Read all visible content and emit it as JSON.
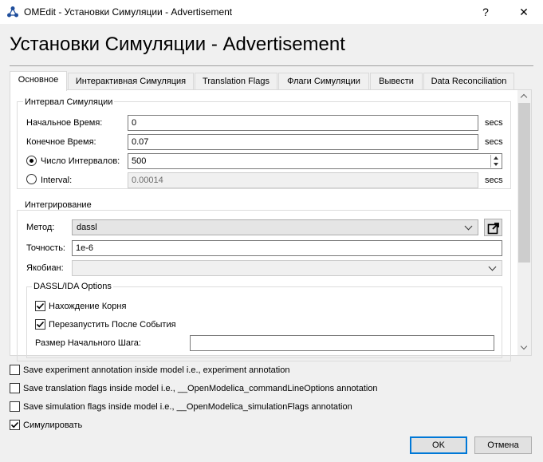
{
  "window": {
    "title": "OMEdit - Установки Симуляции - Advertisement",
    "help_glyph": "?",
    "close_glyph": "✕"
  },
  "heading": "Установки Симуляции - Advertisement",
  "tabs": [
    {
      "label": "Основное",
      "active": true
    },
    {
      "label": "Интерактивная Симуляция"
    },
    {
      "label": "Translation Flags"
    },
    {
      "label": "Флаги Симуляции"
    },
    {
      "label": "Вывести"
    },
    {
      "label": "Data Reconciliation"
    }
  ],
  "interval": {
    "title": "Интервал Симуляции",
    "start_label": "Начальное Время:",
    "start_value": "0",
    "start_unit": "secs",
    "stop_label": "Конечное Время:",
    "stop_value": "0.07",
    "stop_unit": "secs",
    "num_intervals_label": "Число Интервалов:",
    "num_intervals_value": "500",
    "interval_label": "Interval:",
    "interval_value": "0.00014",
    "interval_unit": "secs"
  },
  "integration": {
    "title": "Интегрирование",
    "method_label": "Метод:",
    "method_value": "dassl",
    "tolerance_label": "Точность:",
    "tolerance_value": "1e-6",
    "jacobian_label": "Якобиан:",
    "jacobian_value": "",
    "dassl_title": "DASSL/IDA Options",
    "root_finding_label": "Нахождение Корня",
    "root_finding_checked": true,
    "restart_label": "Перезапустить После События",
    "restart_checked": true,
    "initial_step_label": "Размер Начального Шага:",
    "initial_step_value": ""
  },
  "options": [
    {
      "label": "Save experiment annotation inside model i.e., experiment annotation",
      "checked": false
    },
    {
      "label": "Save translation flags inside model i.e., __OpenModelica_commandLineOptions annotation",
      "checked": false
    },
    {
      "label": "Save simulation flags inside model i.e., __OpenModelica_simulationFlags annotation",
      "checked": false
    },
    {
      "label": "Симулировать",
      "checked": true
    }
  ],
  "buttons": {
    "ok": "OK",
    "cancel": "Отмена"
  },
  "colors": {
    "accent": "#0078d7"
  }
}
